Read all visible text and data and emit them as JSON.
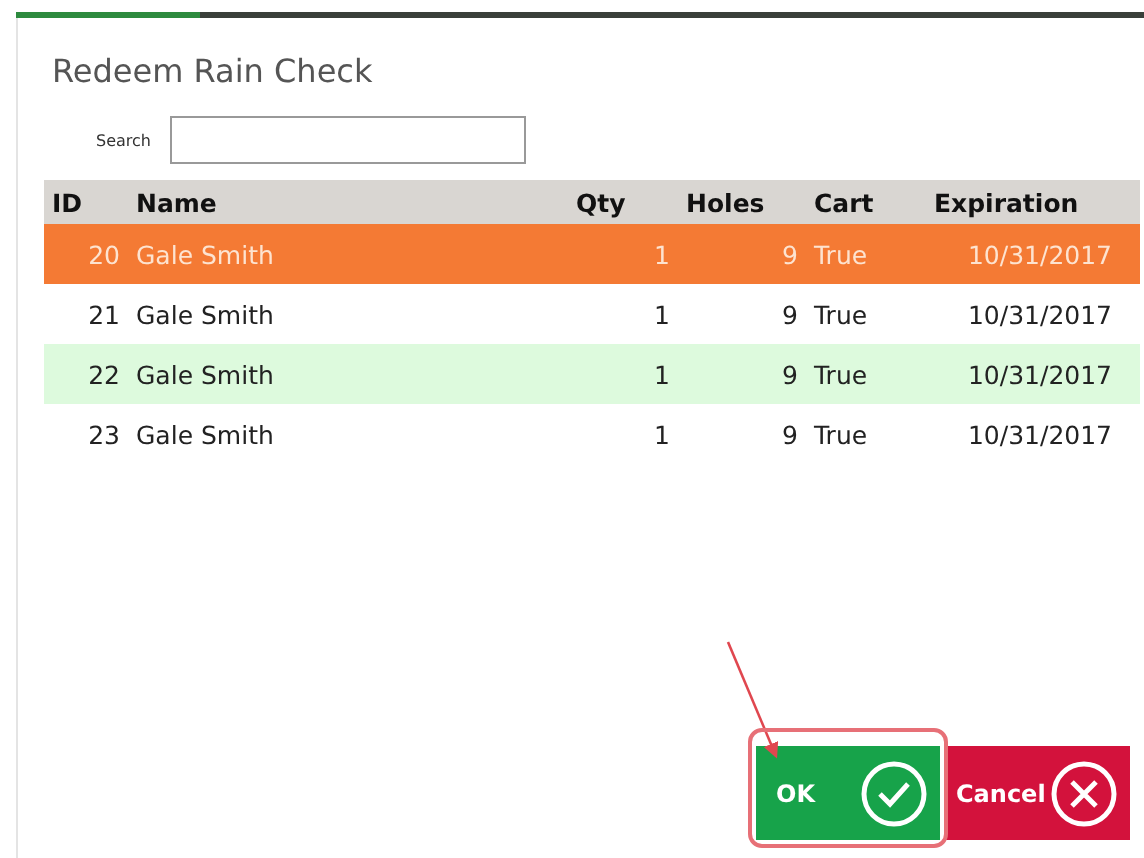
{
  "dialog": {
    "title": "Redeem Rain Check"
  },
  "search": {
    "label": "Search"
  },
  "table": {
    "columns": [
      "ID",
      "Name",
      "Qty",
      "Holes",
      "Cart",
      "Expiration"
    ],
    "rows": [
      {
        "cells": [
          "20",
          "Gale Smith",
          "1",
          "9",
          "True",
          "10/31/2017"
        ],
        "selected": true,
        "highlighted": false
      },
      {
        "cells": [
          "21",
          "Gale Smith",
          "1",
          "9",
          "True",
          "10/31/2017"
        ],
        "selected": false,
        "highlighted": false
      },
      {
        "cells": [
          "22",
          "Gale Smith",
          "1",
          "9",
          "True",
          "10/31/2017"
        ],
        "selected": false,
        "highlighted": true
      },
      {
        "cells": [
          "23",
          "Gale Smith",
          "1",
          "9",
          "True",
          "10/31/2017"
        ],
        "selected": false,
        "highlighted": false
      }
    ]
  },
  "buttons": [
    {
      "label": "OK",
      "kind": "ok"
    },
    {
      "label": "Cancel",
      "kind": "cancel"
    }
  ]
}
